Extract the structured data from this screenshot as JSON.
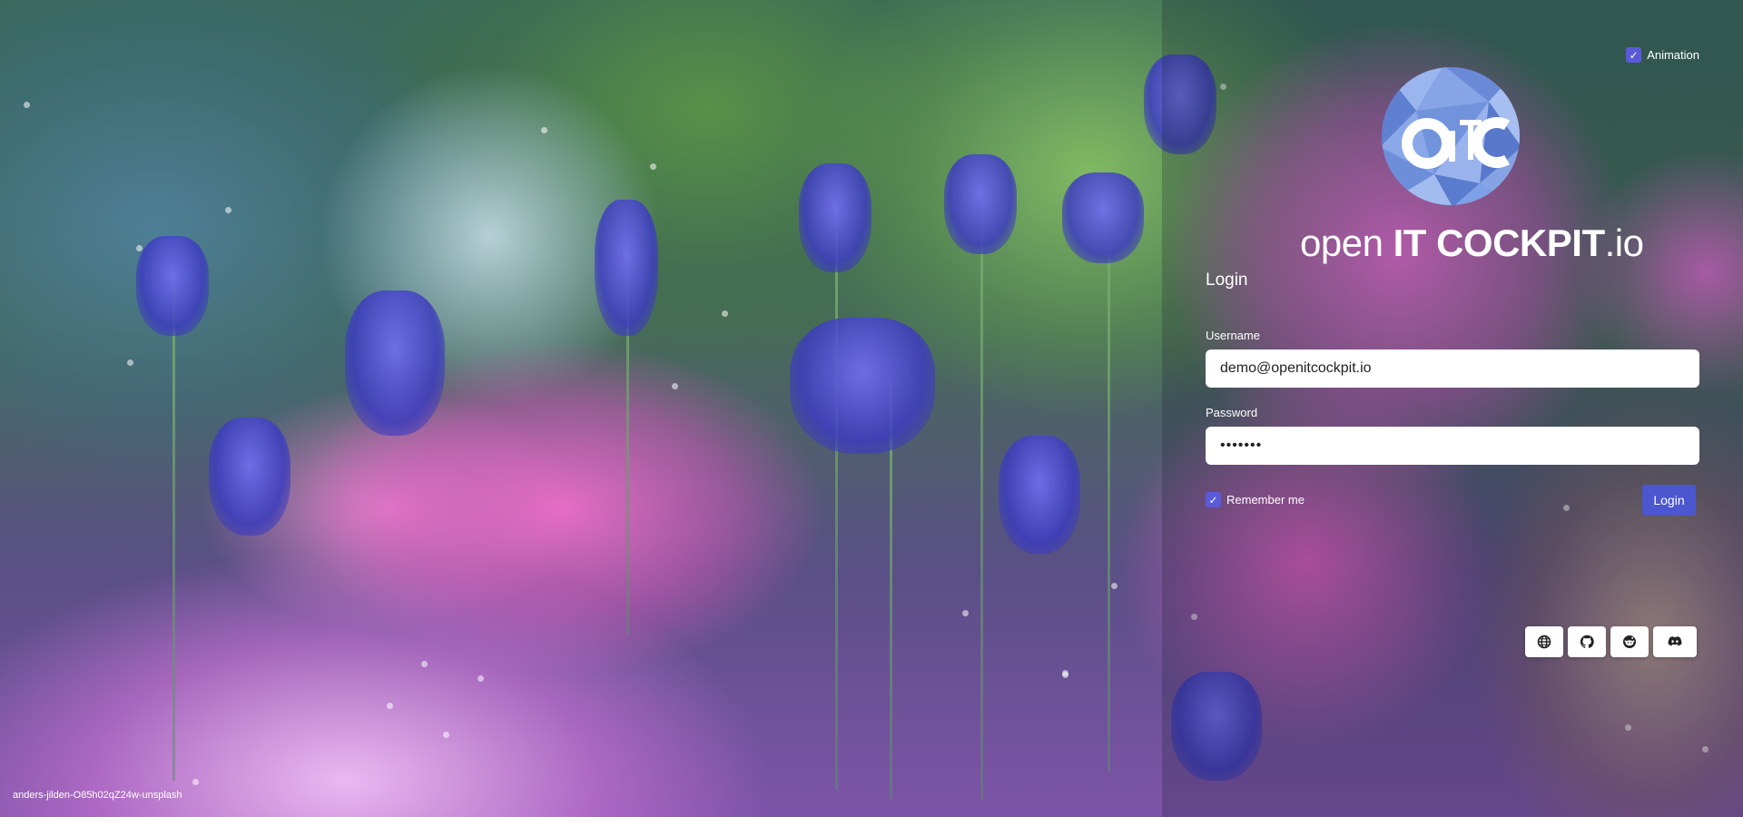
{
  "animation_toggle": {
    "label": "Animation",
    "checked": true,
    "icon": "check-icon"
  },
  "brand": {
    "prefix": "open",
    "name": "IT COCKPIT",
    "suffix": ".io"
  },
  "logo": {
    "letters": "OITC"
  },
  "login_form": {
    "title": "Login",
    "username": {
      "label": "Username",
      "value": "demo@openitcockpit.io"
    },
    "password": {
      "label": "Password",
      "value": "•••••••"
    },
    "remember": {
      "label": "Remember me",
      "checked": true,
      "icon": "check-icon"
    },
    "submit_label": "Login"
  },
  "social_links": [
    {
      "name": "website",
      "icon": "globe-icon"
    },
    {
      "name": "github",
      "icon": "github-icon"
    },
    {
      "name": "reddit",
      "icon": "reddit-icon"
    },
    {
      "name": "discord",
      "icon": "discord-icon"
    }
  ],
  "background": {
    "credit": "anders-jilden-O85h02qZ24w-unsplash"
  },
  "colors": {
    "accent": "#4b56cf",
    "checkbox": "#5a5adb",
    "text": "#ffffff"
  }
}
